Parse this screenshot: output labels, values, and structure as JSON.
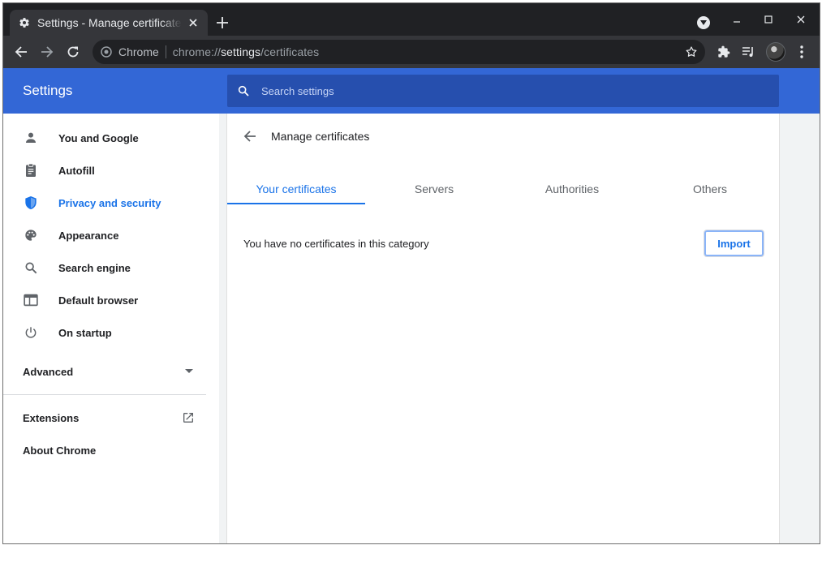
{
  "browser": {
    "tab_title": "Settings - Manage certificates",
    "omnibox_chip": "Chrome",
    "url_scheme": "chrome://",
    "url_host": "settings",
    "url_path": "/certificates",
    "icons": [
      "gear-icon",
      "close-icon",
      "new-tab-icon",
      "tab-search-icon",
      "minimize-icon",
      "maximize-icon",
      "window-close-icon",
      "back-arrow-icon",
      "forward-arrow-icon",
      "reload-icon",
      "chrome-logo-icon",
      "bookmark-star-icon",
      "extensions-icon",
      "media-control-icon",
      "avatar",
      "kebab-menu-icon"
    ]
  },
  "header": {
    "title": "Settings",
    "search_placeholder": "Search settings"
  },
  "sidebar": {
    "items": [
      {
        "label": "You and Google",
        "icon": "person-icon"
      },
      {
        "label": "Autofill",
        "icon": "clipboard-icon"
      },
      {
        "label": "Privacy and security",
        "icon": "shield-icon",
        "active": true
      },
      {
        "label": "Appearance",
        "icon": "palette-icon"
      },
      {
        "label": "Search engine",
        "icon": "search-icon"
      },
      {
        "label": "Default browser",
        "icon": "browser-window-icon"
      },
      {
        "label": "On startup",
        "icon": "power-icon"
      }
    ],
    "advanced_label": "Advanced",
    "extensions_label": "Extensions",
    "about_label": "About Chrome"
  },
  "main": {
    "page_title": "Manage certificates",
    "tabs": [
      {
        "label": "Your certificates",
        "selected": true
      },
      {
        "label": "Servers"
      },
      {
        "label": "Authorities"
      },
      {
        "label": "Others"
      }
    ],
    "empty_message": "You have no certificates in this category",
    "import_label": "Import"
  },
  "colors": {
    "accent": "#1a73e8",
    "header_bg": "#3367d6",
    "search_bg": "#264fae",
    "tabstrip_bg": "#202124",
    "toolbar_bg": "#35363a"
  }
}
